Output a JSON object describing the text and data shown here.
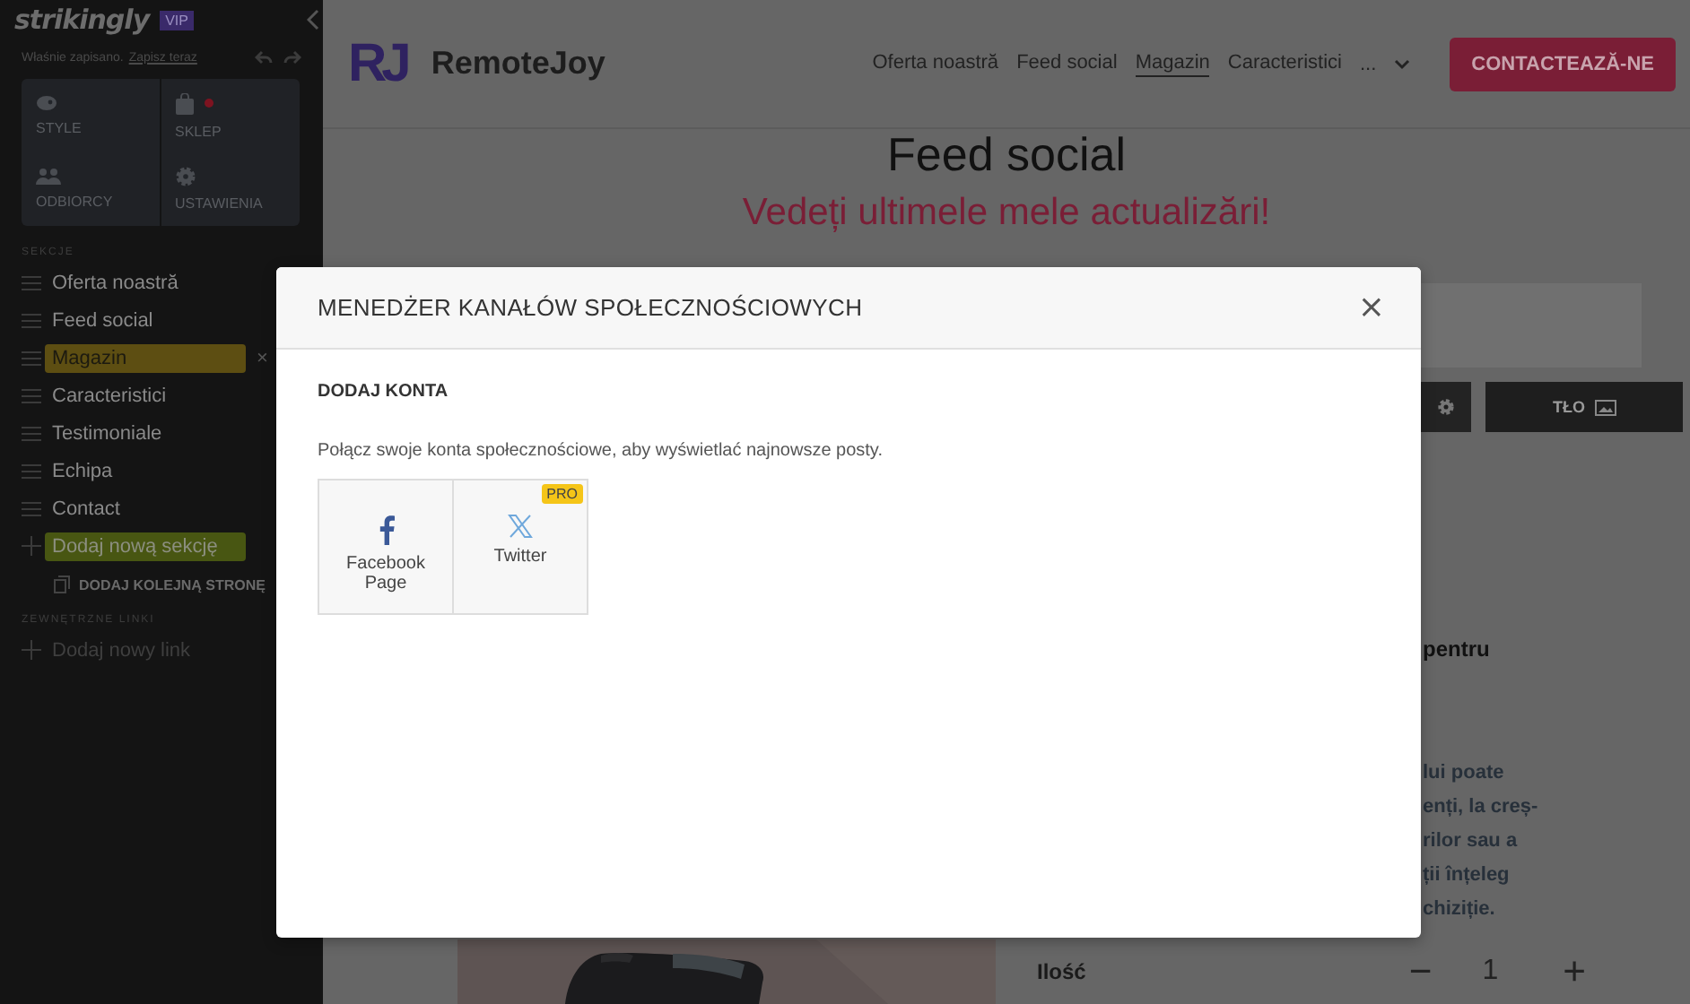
{
  "sidebar": {
    "brand": "strikingly",
    "badge": "VIP",
    "save_status": "Właśnie zapisano.",
    "save_link": "Zapisz teraz",
    "tiles": [
      {
        "label": "STYLE",
        "dot": false
      },
      {
        "label": "SKLEP",
        "dot": true
      },
      {
        "label": "ODBIORCY",
        "dot": false
      },
      {
        "label": "USTAWIENIA",
        "dot": false
      }
    ],
    "sections_heading": "SEKCJE",
    "sections": [
      {
        "label": "Oferta noastră",
        "selected": false
      },
      {
        "label": "Feed social",
        "selected": false
      },
      {
        "label": "Magazin",
        "selected": true
      },
      {
        "label": "Caracteristici",
        "selected": false
      },
      {
        "label": "Testimoniale",
        "selected": false
      },
      {
        "label": "Echipa",
        "selected": false
      },
      {
        "label": "Contact",
        "selected": false
      }
    ],
    "remove_mark": "×",
    "add_section": "Dodaj nową sekcję",
    "add_page": "DODAJ KOLEJNĄ STRONĘ",
    "links_heading": "ZEWNĘTRZNE LINKI",
    "add_link": "Dodaj nowy link"
  },
  "site": {
    "logo_mark": "RJ",
    "name": "RemoteJoy",
    "nav": [
      {
        "label": "Oferta noastră",
        "selected": false
      },
      {
        "label": "Feed social",
        "selected": false
      },
      {
        "label": "Magazin",
        "selected": true
      },
      {
        "label": "Caracteristici",
        "selected": false
      }
    ],
    "more": "...",
    "cta": "CONTACTEAZĂ-NE"
  },
  "page": {
    "heading": "Feed social",
    "subtitle": "Vedeți ultimele mele actualizări!",
    "background_button": "TŁO",
    "side_title": "pentru",
    "side_text": [
      "lui poate",
      "enți, la creș-",
      "rilor sau a",
      "ții înțeleg",
      "chiziție."
    ],
    "quantity_label": "Ilość",
    "minus": "−",
    "quantity": "1",
    "plus": "+"
  },
  "modal": {
    "title": "MENEDŻER KANAŁÓW SPOŁECZNOŚCIOWYCH",
    "close": "×",
    "section_heading": "DODAJ KONTA",
    "description": "Połącz swoje konta społecznościowe, aby wyświetlać najnowsze posty.",
    "accounts": [
      {
        "label": "Facebook Page"
      },
      {
        "label": "Twitter",
        "badge": "PRO"
      }
    ]
  }
}
